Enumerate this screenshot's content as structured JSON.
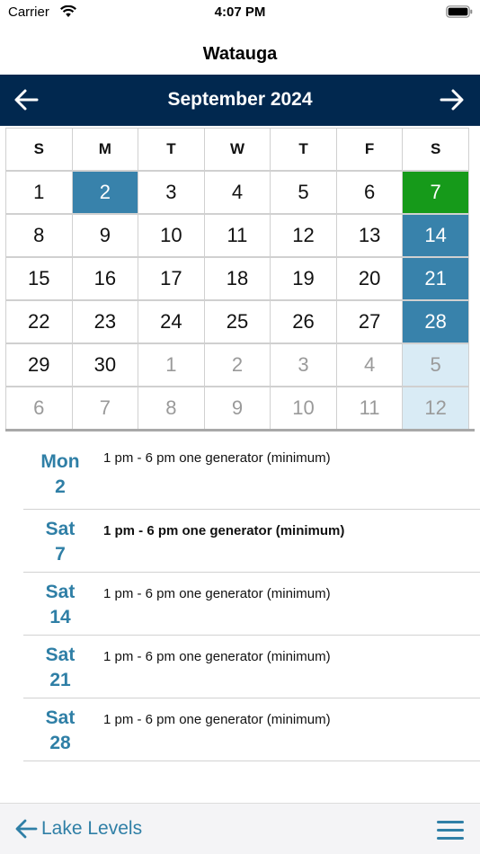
{
  "status_bar": {
    "carrier": "Carrier",
    "time": "4:07 PM"
  },
  "nav": {
    "title": "Watauga"
  },
  "calendar": {
    "month_label": "September 2024",
    "weekdays": [
      "S",
      "M",
      "T",
      "W",
      "T",
      "F",
      "S"
    ],
    "weeks": [
      [
        {
          "d": "1",
          "s": ""
        },
        {
          "d": "2",
          "s": "sel"
        },
        {
          "d": "3",
          "s": ""
        },
        {
          "d": "4",
          "s": ""
        },
        {
          "d": "5",
          "s": ""
        },
        {
          "d": "6",
          "s": ""
        },
        {
          "d": "7",
          "s": "green"
        }
      ],
      [
        {
          "d": "8",
          "s": ""
        },
        {
          "d": "9",
          "s": ""
        },
        {
          "d": "10",
          "s": ""
        },
        {
          "d": "11",
          "s": ""
        },
        {
          "d": "12",
          "s": ""
        },
        {
          "d": "13",
          "s": ""
        },
        {
          "d": "14",
          "s": "sel"
        }
      ],
      [
        {
          "d": "15",
          "s": ""
        },
        {
          "d": "16",
          "s": ""
        },
        {
          "d": "17",
          "s": ""
        },
        {
          "d": "18",
          "s": ""
        },
        {
          "d": "19",
          "s": ""
        },
        {
          "d": "20",
          "s": ""
        },
        {
          "d": "21",
          "s": "sel"
        }
      ],
      [
        {
          "d": "22",
          "s": ""
        },
        {
          "d": "23",
          "s": ""
        },
        {
          "d": "24",
          "s": ""
        },
        {
          "d": "25",
          "s": ""
        },
        {
          "d": "26",
          "s": ""
        },
        {
          "d": "27",
          "s": ""
        },
        {
          "d": "28",
          "s": "sel"
        }
      ],
      [
        {
          "d": "29",
          "s": ""
        },
        {
          "d": "30",
          "s": ""
        },
        {
          "d": "1",
          "s": "other"
        },
        {
          "d": "2",
          "s": "other"
        },
        {
          "d": "3",
          "s": "other"
        },
        {
          "d": "4",
          "s": "other"
        },
        {
          "d": "5",
          "s": "pale"
        }
      ],
      [
        {
          "d": "6",
          "s": "other"
        },
        {
          "d": "7",
          "s": "other"
        },
        {
          "d": "8",
          "s": "other"
        },
        {
          "d": "9",
          "s": "other"
        },
        {
          "d": "10",
          "s": "other"
        },
        {
          "d": "11",
          "s": "other"
        },
        {
          "d": "12",
          "s": "pale"
        }
      ]
    ]
  },
  "schedule": [
    {
      "weekday": "Mon",
      "day": "2",
      "text": "1 pm - 6 pm one generator (minimum)",
      "bold": false
    },
    {
      "weekday": "Sat",
      "day": "7",
      "text": "1 pm - 6 pm one generator (minimum)",
      "bold": true
    },
    {
      "weekday": "Sat",
      "day": "14",
      "text": "1 pm - 6 pm one generator (minimum)",
      "bold": false
    },
    {
      "weekday": "Sat",
      "day": "21",
      "text": "1 pm - 6 pm one generator (minimum)",
      "bold": false
    },
    {
      "weekday": "Sat",
      "day": "28",
      "text": "1 pm - 6 pm one generator (minimum)",
      "bold": false
    }
  ],
  "footer": {
    "back_label": "Lake Levels",
    "back_icon": "arrow-left-icon",
    "menu_icon": "hamburger-menu-icon"
  },
  "colors": {
    "header_bg": "#01284f",
    "selected_day": "#3882ab",
    "today_green": "#169a1a",
    "pale_day": "#d9ebf5",
    "accent": "#2f7fa6"
  }
}
